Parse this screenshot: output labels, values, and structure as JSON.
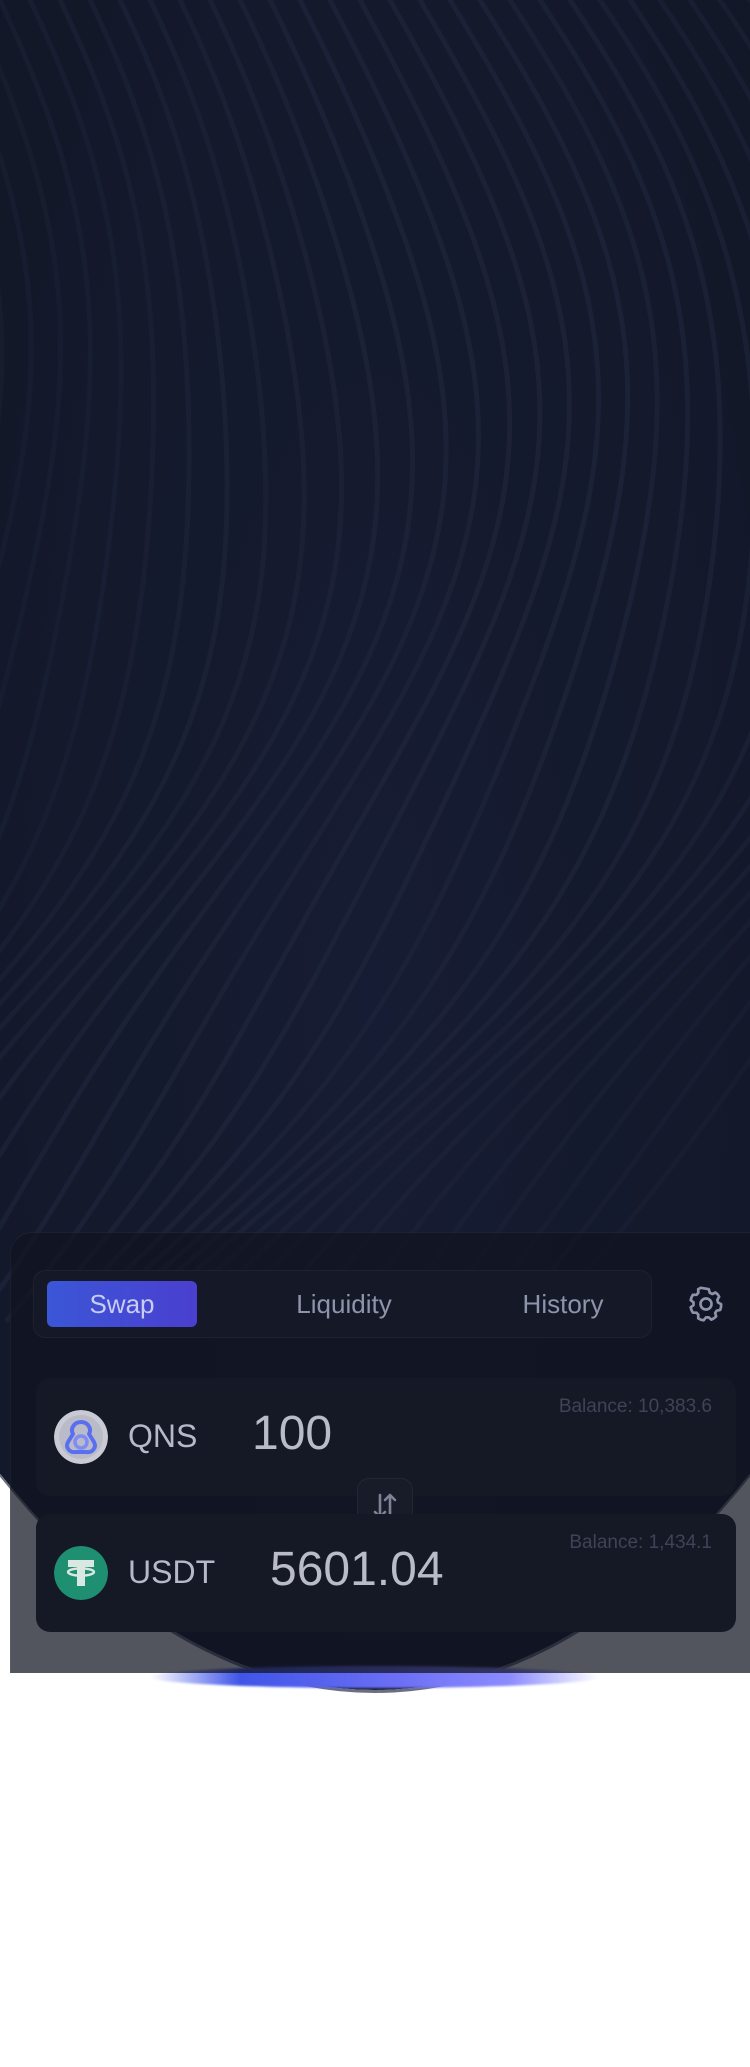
{
  "tabs": [
    {
      "label": "Swap",
      "active": true
    },
    {
      "label": "Liquidity",
      "active": false
    },
    {
      "label": "History",
      "active": false
    }
  ],
  "settings": {
    "icon": "gear-icon"
  },
  "swap": {
    "from": {
      "symbol": "QNS",
      "amount": "100",
      "balance": "Balance: 10,383.6",
      "icon": "qns-logo-icon",
      "color": "#5a6ef0"
    },
    "flip": {
      "icon": "swap-arrows-icon"
    },
    "to": {
      "symbol": "USDT",
      "amount": "5601.04",
      "balance": "Balance: 1,434.1",
      "icon": "usdt-logo-icon",
      "color": "#26a17b"
    }
  },
  "colors": {
    "accent": "#4a3fd0",
    "background": "#11141f"
  }
}
